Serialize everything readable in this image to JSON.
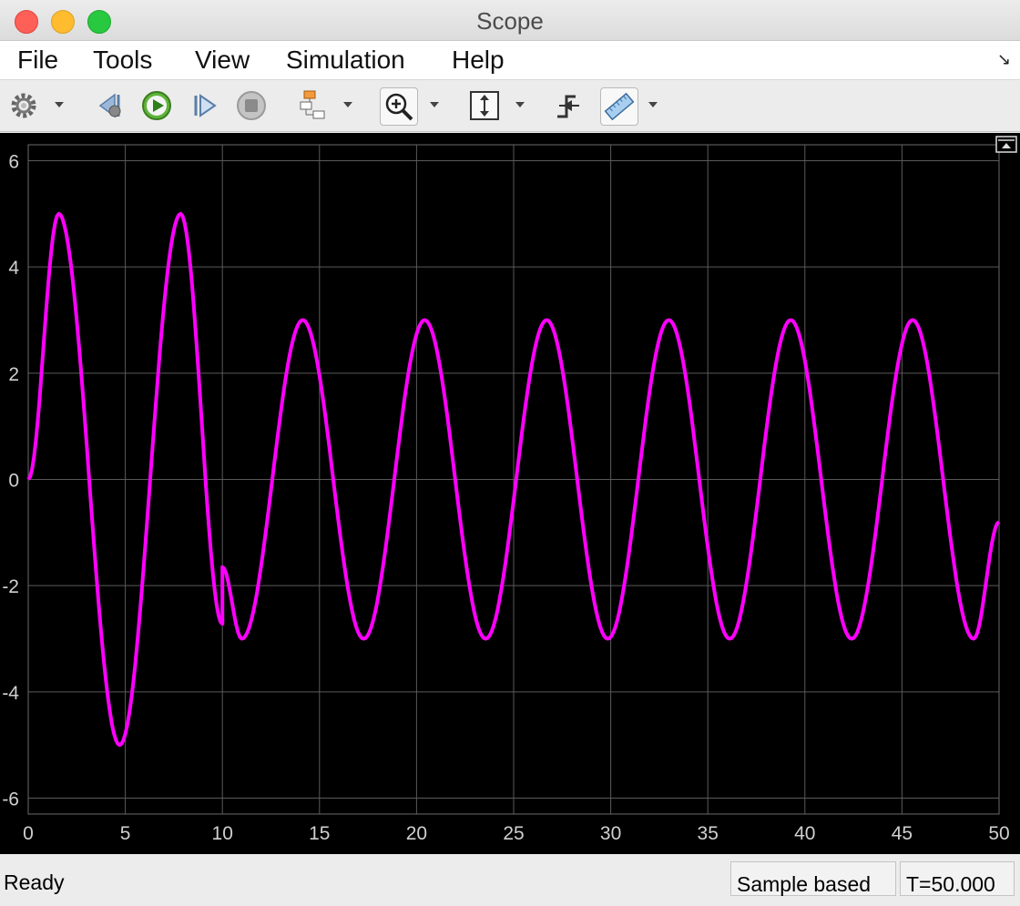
{
  "window": {
    "title": "Scope"
  },
  "menu": {
    "items": [
      "File",
      "Tools",
      "View",
      "Simulation",
      "Help"
    ]
  },
  "toolbar": {
    "icons": [
      "gear-icon",
      "step-back-icon",
      "run-icon",
      "step-forward-icon",
      "stop-icon",
      "signal-selector-icon",
      "zoom-in-icon",
      "scale-axes-icon",
      "triggers-icon",
      "cursor-measurements-icon"
    ]
  },
  "chart_data": {
    "type": "line",
    "title": "",
    "xlabel": "",
    "ylabel": "",
    "xlim": [
      0,
      50
    ],
    "ylim": [
      -6.3,
      6.3
    ],
    "xticks": [
      "0",
      "5",
      "10",
      "15",
      "20",
      "25",
      "30",
      "35",
      "40",
      "45",
      "50"
    ],
    "yticks": [
      "6",
      "4",
      "2",
      "0",
      "-2",
      "-4",
      "-6"
    ],
    "grid": true,
    "background": "#000000",
    "grid_color": "#5a5a5a",
    "series": [
      {
        "color": "#ff00ff",
        "x": [
          0,
          1.57,
          4.71,
          7.85,
          10.0,
          10.0,
          11.0,
          14.14,
          17.28,
          20.42,
          23.56,
          26.7,
          29.85,
          32.99,
          36.13,
          39.27,
          42.41,
          45.55,
          48.69,
          50.0
        ],
        "y": [
          0,
          5.0,
          -5.0,
          5.0,
          -2.72,
          -1.65,
          -3.0,
          3.0,
          -3.0,
          3.0,
          -3.0,
          3.0,
          -3.0,
          3.0,
          -3.0,
          3.0,
          -3.0,
          3.0,
          -3.0,
          -0.8
        ]
      }
    ]
  },
  "status": {
    "ready": "Ready",
    "mode": "Sample based",
    "time": "T=50.000"
  },
  "colors": {
    "accent_line": "#ff00ff"
  }
}
